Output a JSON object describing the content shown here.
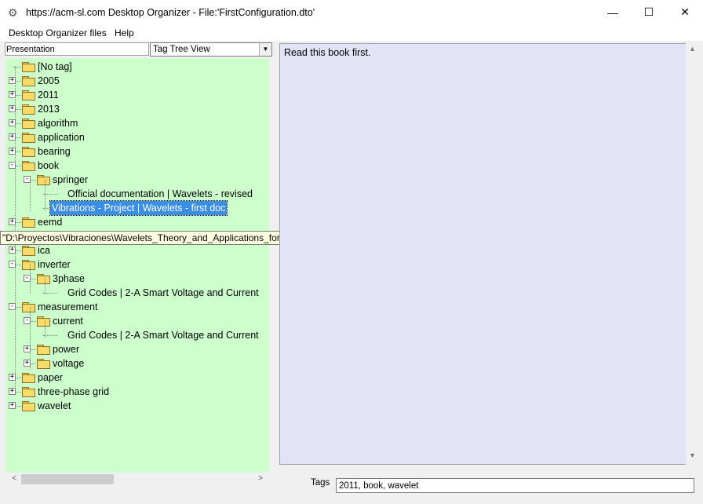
{
  "window": {
    "title": "https://acm-sl.com Desktop Organizer - File:'FirstConfiguration.dto'",
    "minimize": "—",
    "maximize": "☐",
    "close": "✕"
  },
  "menu": {
    "items": [
      "Desktop Organizer files",
      "Help"
    ]
  },
  "left_panel": {
    "presentation_label": "Presentation",
    "view_select_value": "Tag Tree View"
  },
  "tree": {
    "nodes": [
      {
        "label": "[No tag]",
        "expander": ""
      },
      {
        "label": "2005",
        "expander": "+"
      },
      {
        "label": "2011",
        "expander": "+"
      },
      {
        "label": "2013",
        "expander": "+"
      },
      {
        "label": "algorithm",
        "expander": "+"
      },
      {
        "label": "application",
        "expander": "+"
      },
      {
        "label": "bearing",
        "expander": "+"
      },
      {
        "label": "book",
        "expander": "−"
      },
      {
        "label": "springer",
        "expander": "−"
      },
      {
        "label": "Official documentation | Wavelets - revised",
        "expander": ""
      },
      {
        "label": "Vibrations - Project | Wavelets - first doc",
        "expander": ""
      },
      {
        "label": "eemd",
        "expander": "+"
      },
      {
        "label": "ica",
        "expander": "+"
      },
      {
        "label": "inverter",
        "expander": "−"
      },
      {
        "label": "3phase",
        "expander": "−"
      },
      {
        "label": "Grid Codes | 2-A Smart Voltage and Current",
        "expander": ""
      },
      {
        "label": "measurement",
        "expander": "−"
      },
      {
        "label": "current",
        "expander": "−"
      },
      {
        "label": "Grid Codes | 2-A Smart Voltage and Current",
        "expander": ""
      },
      {
        "label": "power",
        "expander": "+"
      },
      {
        "label": "voltage",
        "expander": "+"
      },
      {
        "label": "paper",
        "expander": "+"
      },
      {
        "label": "three-phase grid",
        "expander": "+"
      },
      {
        "label": "wavelet",
        "expander": "+"
      }
    ]
  },
  "tooltip": {
    "text": "\"D:\\Proyectos\\Vibraciones\\Wavelets_Theory_and_Applications_for_Manufacturing.pdf\""
  },
  "description": {
    "text": "Read this book first."
  },
  "tags": {
    "label": "Tags",
    "value": "2011, book, wavelet"
  },
  "colors": {
    "tree_background": "#ccffcc",
    "description_background": "#e3e3f7",
    "selection": "#3a8ee6",
    "tooltip_background": "#ffffe1"
  }
}
